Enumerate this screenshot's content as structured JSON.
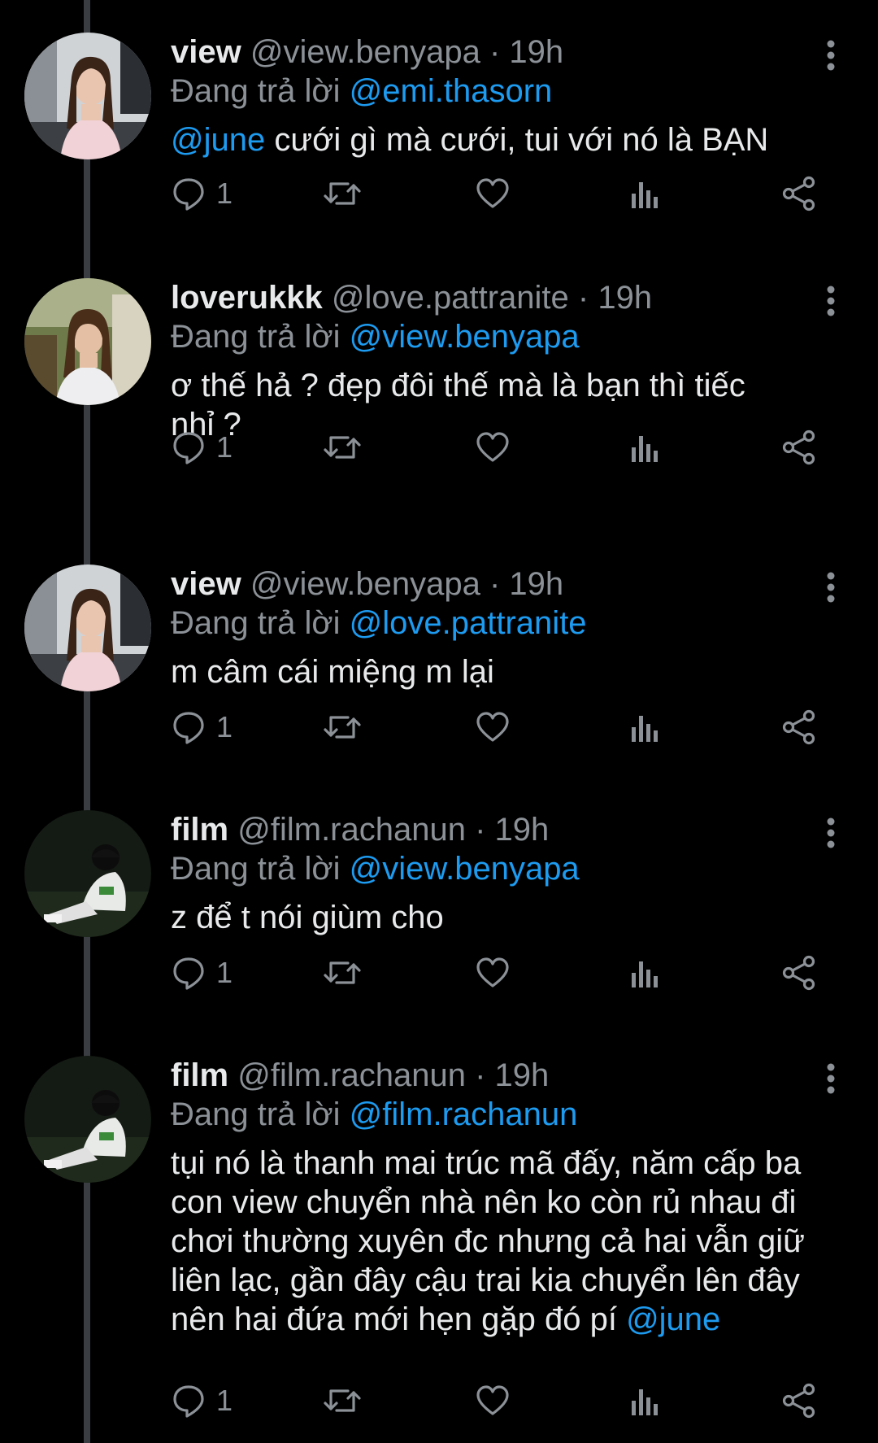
{
  "reply_prefix": "Đang trả lời",
  "tweets": [
    {
      "name": "view",
      "handle": "@view.benyapa",
      "time": "· 19h",
      "replying_to": "@emi.thasorn",
      "mention": "@june",
      "text": " cưới gì mà cưới, tui với nó là BẠN",
      "reply_count": "1",
      "avatar": "avatar-view"
    },
    {
      "name": "loverukkk",
      "handle": "@love.pattranite",
      "time": "· 19h",
      "replying_to": "@view.benyapa",
      "text_line1": "ơ thế hả ? đẹp đôi thế mà là bạn thì tiếc",
      "text_line2": "nhỉ ?",
      "reply_count": "1",
      "avatar": "avatar-loverukkk"
    },
    {
      "name": "view",
      "handle": "@view.benyapa",
      "time": "· 19h",
      "replying_to": "@love.pattranite",
      "text": "m câm cái miệng m lại",
      "reply_count": "1",
      "avatar": "avatar-view"
    },
    {
      "name": "film",
      "handle": "@film.rachanun",
      "time": "· 19h",
      "replying_to": "@view.benyapa",
      "text": "z để t nói giùm cho",
      "reply_count": "1",
      "avatar": "avatar-film"
    },
    {
      "name": "film",
      "handle": "@film.rachanun",
      "time": "· 19h",
      "replying_to": "@film.rachanun",
      "lines": [
        "tụi nó là thanh mai trúc mã đấy, năm cấp ba",
        "con view chuyển nhà nên ko còn rủ nhau đi",
        "chơi thường xuyên đc nhưng cả hai vẫn giữ",
        "liên lạc, gần đây cậu trai kia chuyển lên đây",
        "nên hai đứa mới hẹn gặp đó pí "
      ],
      "end_mention": "@june",
      "reply_count": "1",
      "avatar": "avatar-film"
    }
  ],
  "colors": {
    "mention": "#1d9bf0",
    "muted": "#8b9197",
    "text": "#e7e9ea",
    "background": "#000000"
  }
}
